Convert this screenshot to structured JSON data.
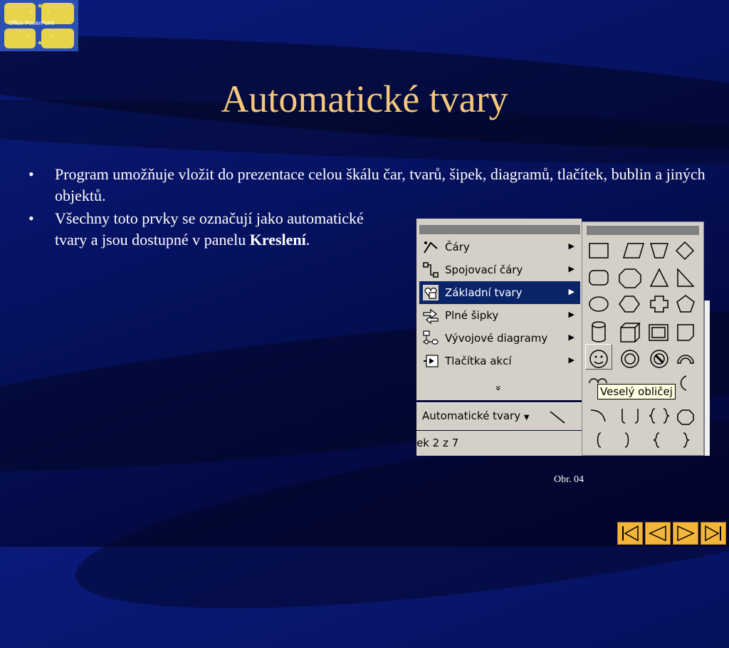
{
  "logo": {
    "text": "Office PowerPoint"
  },
  "slide": {
    "title": "Automatické tvary",
    "bullet1": "Program umožňuje vložit do prezentace celou škálu čar, tvarů, šipek, diagramů, tlačítek, bublin a jiných objektů.",
    "bullet2_part1": "Všechny toto prvky se označují jako automatické tvary a jsou dostupné v panelu ",
    "bullet2_bold": "Kreslení",
    "bullet2_end": ".",
    "bullet_char": "•",
    "caption": "Obr. 04"
  },
  "menu": {
    "items": [
      {
        "label": "Čáry",
        "icon": "lines-icon"
      },
      {
        "label": "Spojovací čáry",
        "icon": "connectors-icon"
      },
      {
        "label": "Základní tvary",
        "icon": "basic-shapes-icon",
        "selected": true
      },
      {
        "label": "Plné šipky",
        "icon": "block-arrows-icon"
      },
      {
        "label": "Vývojové diagramy",
        "icon": "flowchart-icon"
      },
      {
        "label": "Tlačítka akcí",
        "icon": "action-buttons-icon"
      }
    ],
    "more": "»",
    "submenu_arrow": "▶"
  },
  "toolbar": {
    "autoshapes_label": "Automatické tvary",
    "dropdown": "▼"
  },
  "status": {
    "slide_text": "ek 2 z 7"
  },
  "palette": {
    "tooltip": "Veselý obličej",
    "selected_shape": "smiley-face"
  },
  "nav": {
    "buttons": [
      "first-slide",
      "previous-slide",
      "next-slide",
      "last-slide"
    ]
  },
  "colors": {
    "title": "#f4c77a",
    "nav": "#f3b53a",
    "selection": "#0a246a",
    "background": "#061260"
  }
}
